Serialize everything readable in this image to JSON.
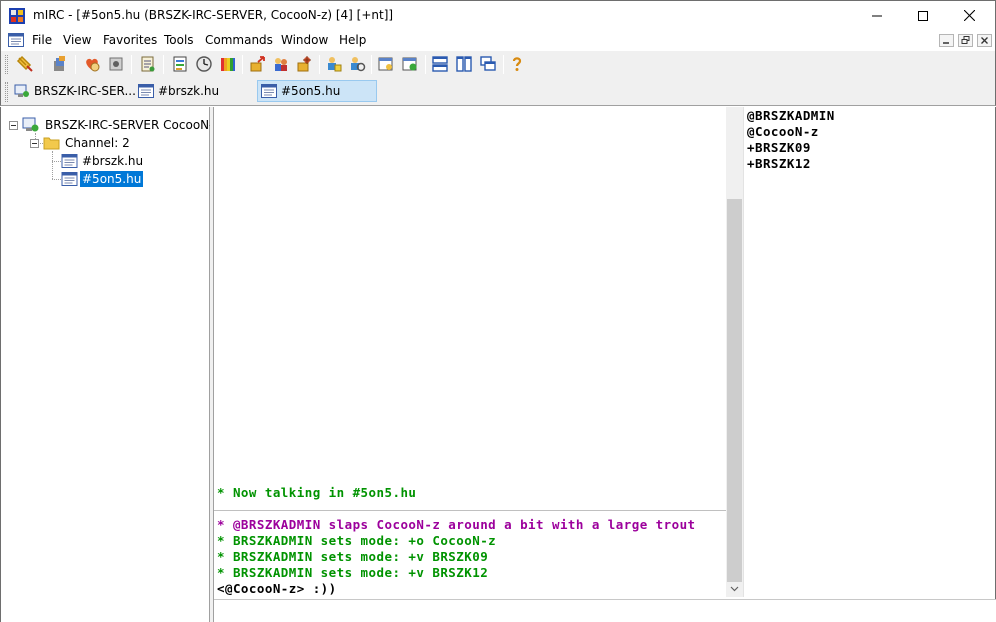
{
  "window": {
    "title": "mIRC - [#5on5.hu (BRSZK-IRC-SERVER, CocooN-z) [4] [+nt]]",
    "minimize_icon": "minimize-icon",
    "maximize_icon": "maximize-icon",
    "close_icon": "close-icon"
  },
  "menu": {
    "items": [
      "File",
      "View",
      "Favorites",
      "Tools",
      "Commands",
      "Window",
      "Help"
    ]
  },
  "toolbar": {
    "icons": [
      "connect-icon",
      "options-icon",
      "address-book-icon",
      "notify-list-icon",
      "channel-list-icon",
      "log-viewer-icon",
      "timer-icon",
      "colors-icon",
      "dcc-send-icon",
      "dcc-chat-icon",
      "dcc-options-icon",
      "scripts-editor-icon",
      "channels-folder-icon",
      "notes-icon",
      "url-catcher-icon",
      "tile-horizontal-icon",
      "tile-vertical-icon",
      "cascade-icon",
      "help-icon"
    ]
  },
  "switchbar": {
    "tabs": [
      {
        "label": "BRSZK-IRC-SER...",
        "active": false
      },
      {
        "label": "#brszk.hu",
        "active": false
      },
      {
        "label": "#5on5.hu",
        "active": true
      }
    ]
  },
  "treebar": {
    "server": "BRSZK-IRC-SERVER CocooN-z",
    "folder": "Channel: 2",
    "channels": [
      {
        "label": "#brszk.hu",
        "selected": false
      },
      {
        "label": "#5on5.hu",
        "selected": true
      }
    ]
  },
  "chat": {
    "lines": [
      {
        "text": "* Now talking in #5on5.hu",
        "color": "#009300"
      },
      {
        "text": "* @BRSZKADMIN slaps CocooN-z around a bit with a large trout",
        "color": "#9c009c"
      },
      {
        "text": "* BRSZKADMIN sets mode: +o CocooN-z",
        "color": "#009300"
      },
      {
        "text": "* BRSZKADMIN sets mode: +v BRSZK09",
        "color": "#009300"
      },
      {
        "text": "* BRSZKADMIN sets mode: +v BRSZK12",
        "color": "#009300"
      },
      {
        "text": "<@CocooN-z> :))",
        "color": "#000000"
      }
    ]
  },
  "nicklist": [
    "@BRSZKADMIN",
    "@CocooN-z",
    "+BRSZK09",
    "+BRSZK12"
  ],
  "editbox": {
    "value": ""
  }
}
